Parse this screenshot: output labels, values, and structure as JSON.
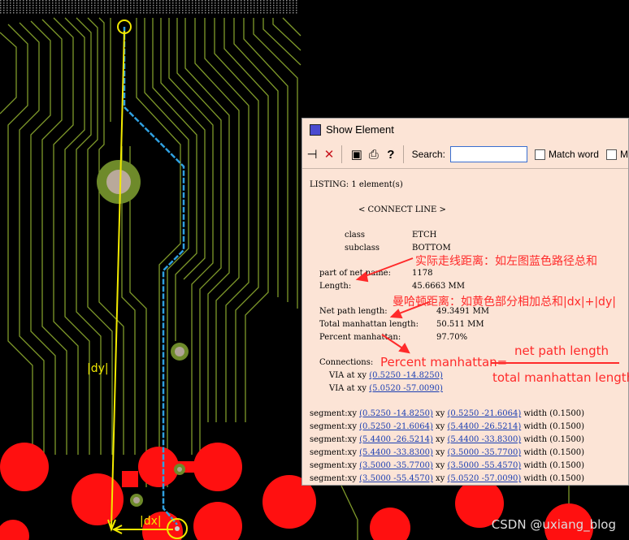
{
  "window": {
    "title": "Show Element",
    "search_label": "Search:",
    "search_value": "",
    "match_word_label": "Match word",
    "checkbox2_label": "M",
    "toolbar_icons": [
      "pin-icon",
      "close-icon",
      "save-icon",
      "print-icon",
      "help-icon"
    ]
  },
  "listing": {
    "header": "LISTING: 1 element(s)",
    "element_type": "< CONNECT LINE >",
    "class_label": "class",
    "class_value": "ETCH",
    "subclass_label": "subclass",
    "subclass_value": "BOTTOM",
    "net_name_label": "part of net name:",
    "net_name_value": "1178",
    "length_label": "Length:",
    "length_value": "45.6663 MM",
    "net_path_label": "Net path length:",
    "net_path_value": "49.3491 MM",
    "total_manhattan_label": "Total manhattan length:",
    "total_manhattan_value": "50.511 MM",
    "percent_manhattan_label": "Percent manhattan:",
    "percent_manhattan_value": "97.70%",
    "connections_label": "Connections:",
    "connections": [
      {
        "prefix": "VIA at xy",
        "coord": "(0.5250 -14.8250)"
      },
      {
        "prefix": "VIA at xy",
        "coord": "(5.0520 -57.0090)"
      }
    ],
    "segments": [
      {
        "from": "(0.5250 -14.8250)",
        "to": "(0.5250 -21.6064)",
        "width": "(0.1500)"
      },
      {
        "from": "(0.5250 -21.6064)",
        "to": "(5.4400 -26.5214)",
        "width": "(0.1500)"
      },
      {
        "from": "(5.4400 -26.5214)",
        "to": "(5.4400 -33.8300)",
        "width": "(0.1500)"
      },
      {
        "from": "(5.4400 -33.8300)",
        "to": "(3.5000 -35.7700)",
        "width": "(0.1500)"
      },
      {
        "from": "(3.5000 -35.7700)",
        "to": "(3.5000 -55.4570)",
        "width": "(0.1500)"
      },
      {
        "from": "(3.5000 -55.4570)",
        "to": "(5.0520 -57.0090)",
        "width": "(0.1500)"
      }
    ],
    "segment_prefix": "segment:xy",
    "xy_word": "xy",
    "width_word": "width"
  },
  "annotations": {
    "actual_length": "实际走线距离：如左图蓝色路径总和",
    "manhattan": "曼哈顿距离：如黄色部分相加总和|dx|+|dy|",
    "percent_formula_left": "Percent manhattan=",
    "formula_numerator": "net path length",
    "formula_denominator": "total manhattan length"
  },
  "pcb": {
    "dy_label": "|dy|",
    "dx_label": "|dx|",
    "colors": {
      "trace": "#7f9a2a",
      "route": "#2fa0e0",
      "measure": "#f2ea00",
      "pad": "#ff1010",
      "annot": "#ff2a2a"
    }
  },
  "watermark": "CSDN @uxiang_blog"
}
